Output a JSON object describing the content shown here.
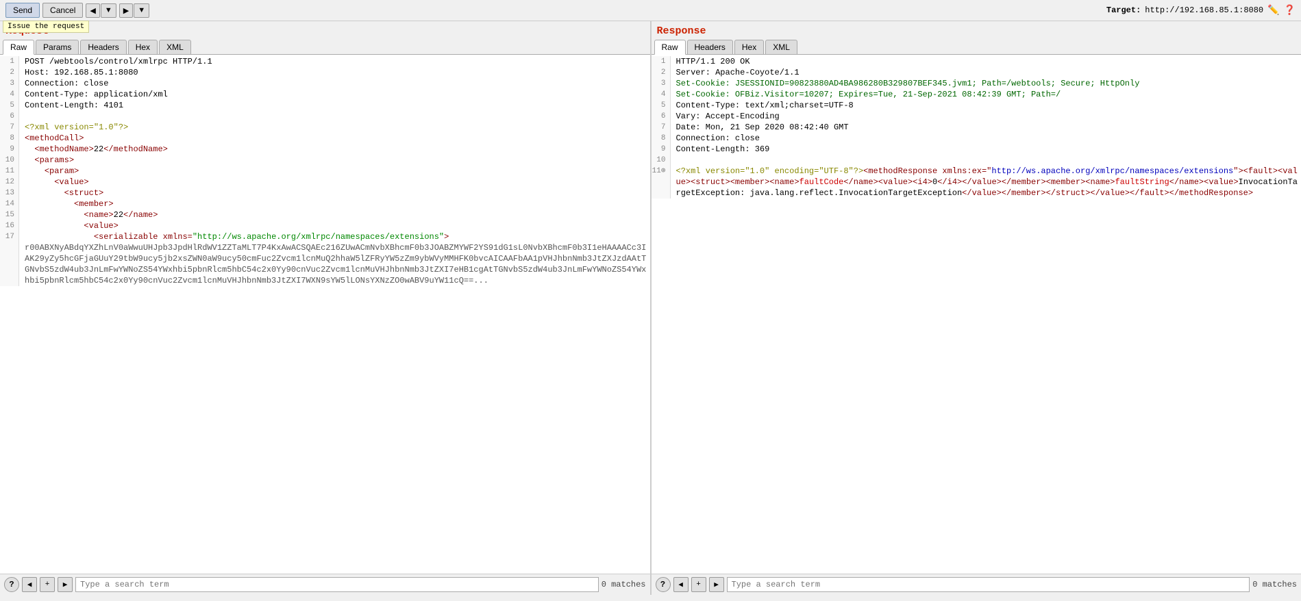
{
  "toolbar": {
    "send_label": "Send",
    "cancel_label": "Cancel",
    "prev_label": "◀",
    "prev_drop_label": "▼",
    "next_label": "▶",
    "next_drop_label": "▼",
    "tooltip": "Issue the request",
    "target_label": "Target:",
    "target_url": "http://192.168.85.1:8080"
  },
  "request": {
    "title": "Request",
    "tabs": [
      {
        "label": "Raw",
        "active": true
      },
      {
        "label": "Params",
        "active": false
      },
      {
        "label": "Headers",
        "active": false
      },
      {
        "label": "Hex",
        "active": false
      },
      {
        "label": "XML",
        "active": false
      }
    ]
  },
  "response": {
    "title": "Response",
    "tabs": [
      {
        "label": "Raw",
        "active": true
      },
      {
        "label": "Headers",
        "active": false
      },
      {
        "label": "Hex",
        "active": false
      },
      {
        "label": "XML",
        "active": false
      }
    ]
  },
  "search_request": {
    "placeholder": "Type a search term",
    "matches": "0 matches"
  },
  "search_response": {
    "placeholder": "Type a search term",
    "matches": "0 matches"
  }
}
